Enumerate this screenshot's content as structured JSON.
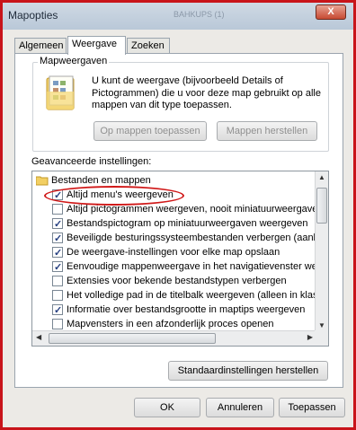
{
  "window": {
    "title": "Mapopties",
    "ghost_title": "BAHKUPS (1)",
    "close_symbol": "X"
  },
  "tabs": [
    {
      "label": "Algemeen",
      "active": false
    },
    {
      "label": "Weergave",
      "active": true
    },
    {
      "label": "Zoeken",
      "active": false
    }
  ],
  "folder_views": {
    "legend": "Mapweergaven",
    "description": "U kunt de weergave (bijvoorbeeld Details of Pictogrammen) die u voor deze map gebruikt op alle mappen van dit type toepassen.",
    "apply_button": "Op mappen toepassen",
    "reset_button": "Mappen herstellen"
  },
  "advanced": {
    "label": "Geavanceerde instellingen:",
    "category": "Bestanden en mappen",
    "items": [
      {
        "label": "Altijd menu's weergeven",
        "checked": true
      },
      {
        "label": "Altijd pictogrammen weergeven, nooit miniatuurweergaven",
        "checked": false
      },
      {
        "label": "Bestandspictogram op miniatuurweergaven weergeven",
        "checked": true
      },
      {
        "label": "Beveiligde besturingssysteembestanden verbergen (aanbevolen)",
        "checked": true
      },
      {
        "label": "De weergave-instellingen voor elke map opslaan",
        "checked": true
      },
      {
        "label": "Eenvoudige mappenweergave in het navigatievenster weergeven",
        "checked": true
      },
      {
        "label": "Extensies voor bekende bestandstypen verbergen",
        "checked": false
      },
      {
        "label": "Het volledige pad in de titelbalk weergeven (alleen in klassiek thema)",
        "checked": false
      },
      {
        "label": "Informatie over bestandsgrootte in maptips weergeven",
        "checked": true
      },
      {
        "label": "Mapvensters in een afzonderlijk proces openen",
        "checked": false
      }
    ],
    "restore_defaults_button": "Standaardinstellingen herstellen"
  },
  "footer": {
    "ok": "OK",
    "cancel": "Annuleren",
    "apply": "Toepassen"
  },
  "colors": {
    "annotation": "#d01818",
    "check": "#263f80"
  }
}
